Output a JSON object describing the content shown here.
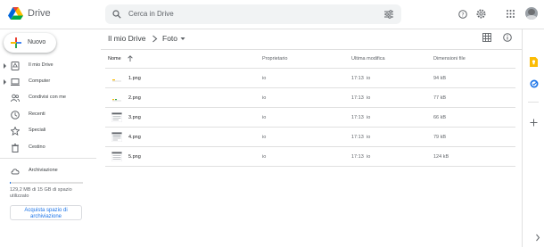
{
  "app": {
    "name": "Drive"
  },
  "search": {
    "placeholder": "Cerca in Drive"
  },
  "header_icons": [
    "help-icon",
    "settings-icon",
    "apps-grid-icon",
    "account-avatar"
  ],
  "new_button": {
    "label": "Nuovo"
  },
  "sidebar": {
    "items": [
      {
        "label": "Il mio Drive",
        "icon": "my-drive-icon",
        "expandable": true
      },
      {
        "label": "Computer",
        "icon": "computer-icon",
        "expandable": true
      },
      {
        "label": "Condivisi con me",
        "icon": "shared-icon",
        "expandable": false
      },
      {
        "label": "Recenti",
        "icon": "clock-icon",
        "expandable": false
      },
      {
        "label": "Speciali",
        "icon": "star-icon",
        "expandable": false
      },
      {
        "label": "Cestino",
        "icon": "trash-icon",
        "expandable": false
      }
    ],
    "storage_label": "Archiviazione",
    "storage_text": "129,2 MB di 15 GB di spazio utilizzato",
    "storage_used_fraction": 0.0086,
    "buy_label": "Acquista spazio di archiviazione"
  },
  "breadcrumb": {
    "root": "Il mio Drive",
    "current": "Foto"
  },
  "table": {
    "columns": {
      "name": "Nome",
      "owner": "Proprietario",
      "modified": "Ultima modifica",
      "size": "Dimensioni file"
    },
    "rows": [
      {
        "name": "1.png",
        "owner": "io",
        "modified": "17:13",
        "modified_by": "io",
        "size": "94 kB"
      },
      {
        "name": "2.png",
        "owner": "io",
        "modified": "17:13",
        "modified_by": "io",
        "size": "77 kB"
      },
      {
        "name": "3.png",
        "owner": "io",
        "modified": "17:13",
        "modified_by": "io",
        "size": "66 kB"
      },
      {
        "name": "4.png",
        "owner": "io",
        "modified": "17:13",
        "modified_by": "io",
        "size": "79 kB"
      },
      {
        "name": "5.png",
        "owner": "io",
        "modified": "17:13",
        "modified_by": "io",
        "size": "124 kB"
      }
    ]
  },
  "colors": {
    "accent": "#1a73e8",
    "keep": "#fbbc04",
    "tasks": "#1a73e8"
  }
}
